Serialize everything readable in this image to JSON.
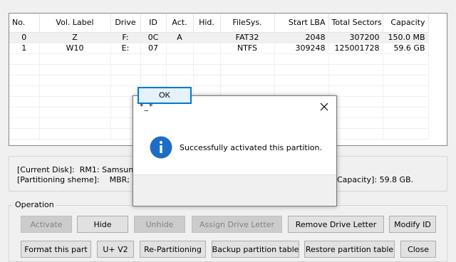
{
  "table": {
    "columns": [
      "No.",
      "Vol. Label",
      "Drive",
      "ID",
      "Act.",
      "Hid.",
      "FileSys.",
      "Start LBA",
      "Total Sectors",
      "Capacity"
    ],
    "rows": [
      [
        "0",
        "Z",
        "F:",
        "0C",
        "A",
        "",
        "FAT32",
        "2048",
        "307200",
        "150.0 MB"
      ],
      [
        "1",
        "W10",
        "E:",
        "07",
        "",
        "",
        "NTFS",
        "309248",
        "125001728",
        "59.6 GB"
      ]
    ]
  },
  "disk_info": {
    "current_disk_label": "[Current Disk]:",
    "current_disk_value": "RM1: Samsung F",
    "scheme_label": "[Partitioning sheme]:",
    "scheme_value": "MBR;",
    "capacity_text": "Capacity]: 59.8 GB."
  },
  "operation": {
    "title": "Operation",
    "row1": [
      "Activate",
      "Hide",
      "Unhide",
      "Assign Drive Letter",
      "Remove Drive Letter",
      "Modify ID"
    ],
    "row2": [
      "Format this part",
      "U+ V2",
      "Re-Partitioning",
      "Backup partition table",
      "Restore partition table",
      "Close"
    ]
  },
  "dialog": {
    "title": "*_*",
    "message": "Successfully activated this partition.",
    "ok_label": "OK",
    "icon": "info-icon",
    "icon_color": "#1c6ec5"
  }
}
